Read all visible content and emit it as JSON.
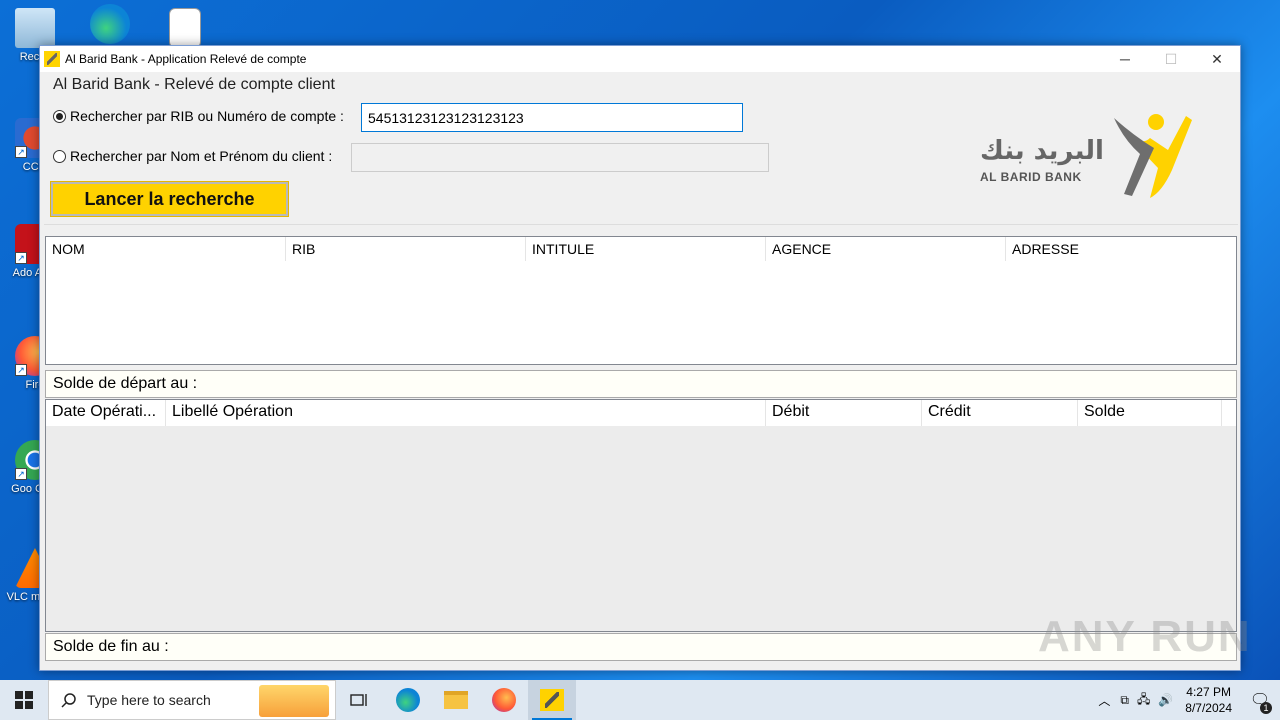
{
  "desktop": {
    "icons": [
      {
        "label": "Recyc"
      },
      {
        "label": "CCle"
      },
      {
        "label": "Ado Acro"
      },
      {
        "label": "Fire"
      },
      {
        "label": "Goo Chro"
      },
      {
        "label": "VLC m play"
      }
    ]
  },
  "window": {
    "title": "Al Barid Bank - Application Relevé de compte",
    "group_title": "Al Barid Bank - Relevé de compte client",
    "radio_rib_label": "Rechercher par RIB ou Numéro de compte :",
    "rib_value": "54513123123123123123",
    "radio_name_label": "Rechercher par Nom et Prénom du client :",
    "name_value": "",
    "search_button": "Lancer la recherche",
    "logo_arabic": "البريد بنك",
    "logo_latin": "AL BARID BANK",
    "clients_columns": [
      "NOM",
      "RIB",
      "INTITULE",
      "AGENCE",
      "ADRESSE"
    ],
    "solde_depart": "Solde de départ au  :",
    "operations_columns": [
      "Date Opérati...",
      "Libellé Opération",
      "Débit",
      "Crédit",
      "Solde"
    ],
    "solde_fin": "Solde de fin au  :"
  },
  "taskbar": {
    "search_placeholder": "Type here to search",
    "time": "4:27 PM",
    "date": "8/7/2024",
    "notification_count": "1"
  },
  "watermark": "ANY RUN",
  "colors": {
    "accent_yellow": "#ffd200",
    "desktop_blue": "#0a5fc4",
    "focus_blue": "#0078d7"
  }
}
